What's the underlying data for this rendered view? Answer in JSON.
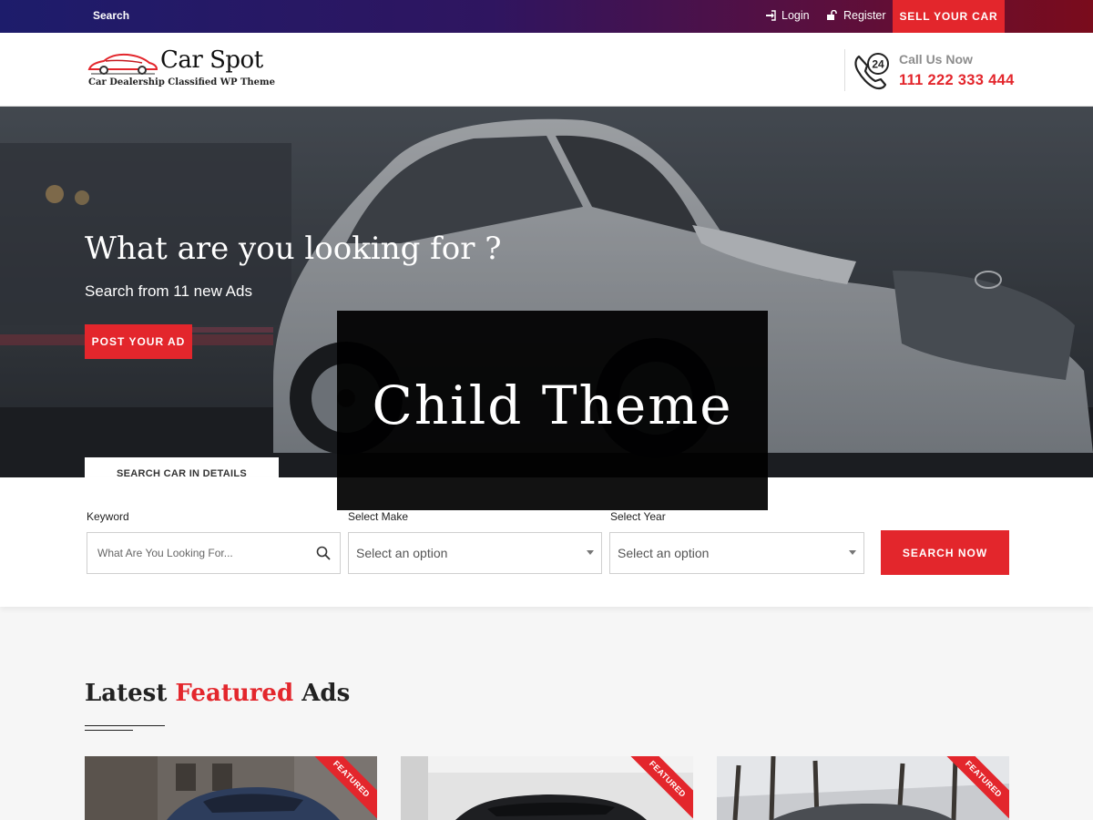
{
  "topbar": {
    "search_label": "Search",
    "login_label": "Login",
    "register_label": "Register",
    "sell_label": "SELL YOUR CAR"
  },
  "header": {
    "logo_name": "Car Spot",
    "logo_tagline": "Car Dealership Classified WP Theme",
    "call_label": "Call Us Now",
    "call_number": "111 222 333 444",
    "phone_badge": "24"
  },
  "hero": {
    "title": "What are you looking for ?",
    "subtitle": "Search from 11 new Ads",
    "post_ad_label": "POST YOUR AD",
    "tab_label": "SEARCH CAR IN DETAILS"
  },
  "search": {
    "keyword_label": "Keyword",
    "keyword_placeholder": "What Are You Looking For...",
    "make_label": "Select Make",
    "make_value": "Select an option",
    "year_label": "Select Year",
    "year_value": "Select an option",
    "submit_label": "SEARCH NOW"
  },
  "latest": {
    "title_part1": "Latest",
    "title_highlight": "Featured",
    "title_part2": "Ads",
    "cards": [
      {
        "ribbon": "FEATURED"
      },
      {
        "ribbon": "FEATURED"
      },
      {
        "ribbon": "FEATURED"
      }
    ]
  },
  "overlay": {
    "text": "Child Theme"
  },
  "colors": {
    "accent": "#e3262c",
    "topbar_start": "#1d1c6b",
    "topbar_end": "#7a0c1c"
  }
}
